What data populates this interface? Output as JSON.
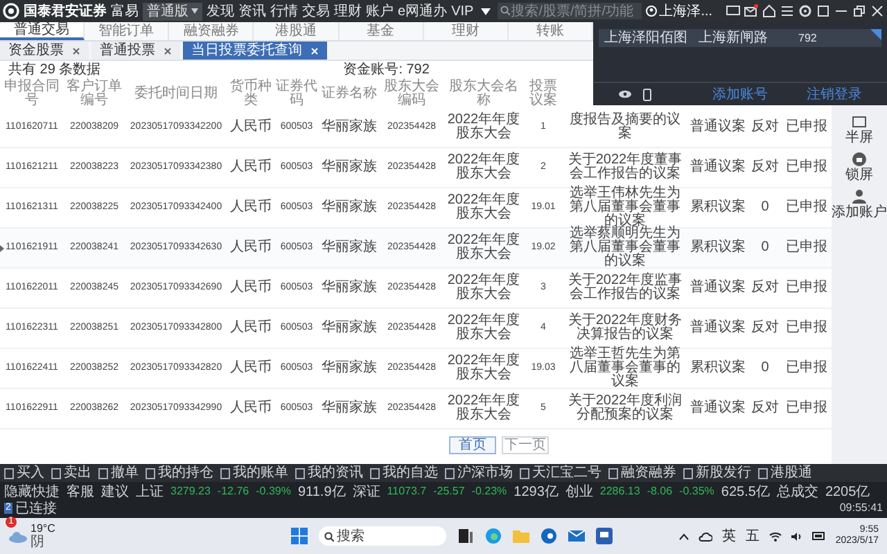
{
  "app": {
    "logo": "国泰君安证券",
    "product": "富易",
    "edition": "普通版",
    "menu": [
      "发现",
      "资讯",
      "行情",
      "交易",
      "理财",
      "账户",
      "e网通办",
      "VIP"
    ],
    "search": {
      "placeholder": "搜索/股票/简拼/功能"
    },
    "account": "上海泽..."
  },
  "main_tabs": [
    {
      "label": "普通交易",
      "selected": true
    },
    {
      "label": "智能订单",
      "selected": false
    },
    {
      "label": "融资融券",
      "selected": false
    },
    {
      "label": "港股通",
      "selected": false
    },
    {
      "label": "基金",
      "selected": false
    },
    {
      "label": "理财",
      "selected": false
    },
    {
      "label": "转账",
      "selected": false
    }
  ],
  "sub_tabs": [
    {
      "label": "资金股票",
      "selected": false
    },
    {
      "label": "普通投票",
      "selected": false
    },
    {
      "label": "当日投票委托查询",
      "selected": true
    }
  ],
  "summary": {
    "count": "共有 29 条数据",
    "account": "资金账号: 792"
  },
  "table": {
    "columns": [
      "申报合同号",
      "客户订单编号",
      "委托时间日期",
      "货币种类",
      "证券代码",
      "证券名称",
      "股东大会编码",
      "股东大会名称",
      "投票议案"
    ],
    "rows": [
      {
        "selected": false,
        "cells": [
          "1101620711",
          "220038209",
          "20230517093342200",
          "人民币",
          "600503",
          "华丽家族",
          "202354428",
          "2022年年度股东大会",
          "1",
          "度报告及摘要的议案",
          "普通议案",
          "反对",
          "已申报"
        ]
      },
      {
        "selected": false,
        "cells": [
          "1101621211",
          "220038223",
          "20230517093342380",
          "人民币",
          "600503",
          "华丽家族",
          "202354428",
          "2022年年度股东大会",
          "2",
          "关于2022年度董事会工作报告的议案",
          "普通议案",
          "反对",
          "已申报"
        ]
      },
      {
        "selected": false,
        "cells": [
          "1101621311",
          "220038225",
          "20230517093342400",
          "人民币",
          "600503",
          "华丽家族",
          "202354428",
          "2022年年度股东大会",
          "19.01",
          "选举王伟林先生为第八届董事会董事的议案",
          "累积议案",
          "0",
          "已申报"
        ]
      },
      {
        "selected": true,
        "cells": [
          "1101621911",
          "220038241",
          "20230517093342630",
          "人民币",
          "600503",
          "华丽家族",
          "202354428",
          "2022年年度股东大会",
          "19.02",
          "选举蔡顺明先生为第八届董事会董事的议案",
          "累积议案",
          "0",
          "已申报"
        ]
      },
      {
        "selected": false,
        "cells": [
          "1101622011",
          "220038245",
          "20230517093342690",
          "人民币",
          "600503",
          "华丽家族",
          "202354428",
          "2022年年度股东大会",
          "3",
          "关于2022年度监事会工作报告的议案",
          "普通议案",
          "反对",
          "已申报"
        ]
      },
      {
        "selected": false,
        "cells": [
          "1101622311",
          "220038251",
          "20230517093342800",
          "人民币",
          "600503",
          "华丽家族",
          "202354428",
          "2022年年度股东大会",
          "4",
          "关于2022年度财务决算报告的议案",
          "普通议案",
          "反对",
          "已申报"
        ]
      },
      {
        "selected": false,
        "cells": [
          "1101622411",
          "220038252",
          "20230517093342820",
          "人民币",
          "600503",
          "华丽家族",
          "202354428",
          "2022年年度股东大会",
          "19.03",
          "选举王哲先生为第八届董事会董事的议案",
          "累积议案",
          "0",
          "已申报"
        ]
      },
      {
        "selected": false,
        "cells": [
          "1101622911",
          "220038262",
          "20230517093342990",
          "人民币",
          "600503",
          "华丽家族",
          "202354428",
          "2022年年度股东大会",
          "5",
          "关于2022年度利润分配预案的议案",
          "普通议案",
          "反对",
          "已申报"
        ]
      }
    ]
  },
  "pagination": [
    {
      "label": "首页",
      "disabled": false
    },
    {
      "label": "下一页",
      "disabled": true
    }
  ],
  "account_panel": {
    "name": "上海泽阳佰图",
    "branch": "上海新闸路",
    "account": "792",
    "actions": [
      "添加账号",
      "注销登录"
    ]
  },
  "side_tools": [
    "半屏",
    "锁屏",
    "添加账户"
  ],
  "toolbar": [
    "买入",
    "卖出",
    "撤单",
    "我的持仓",
    "我的账单",
    "我的资讯",
    "我的自选",
    "沪深市场",
    "天汇宝二号",
    "融资融券",
    "新股发行",
    "港股通"
  ],
  "status_bar": {
    "quick": [
      "隐藏快捷",
      "客服",
      "建议"
    ],
    "indices": [
      {
        "name": "上证",
        "value": "3279.23",
        "change": "-12.76",
        "percent": "-0.39%",
        "volume": "911.9亿"
      },
      {
        "name": "深证",
        "value": "11073.7",
        "change": "-25.57",
        "percent": "-0.23%",
        "volume": "1293亿"
      },
      {
        "name": "创业",
        "value": "2286.13",
        "change": "-8.06",
        "percent": "-0.35%",
        "volume": "625.5亿"
      }
    ],
    "total_label": "总成交",
    "total": "2205亿",
    "connection_badge": "2",
    "connection": "已连接",
    "clock": "09:55:41"
  },
  "taskbar": {
    "temperature": "19°C",
    "weather": "阴",
    "weather_badge": "1",
    "search_placeholder": "搜索",
    "ime": [
      "英",
      "五"
    ],
    "time": "9:55",
    "date": "2023/5/17"
  }
}
